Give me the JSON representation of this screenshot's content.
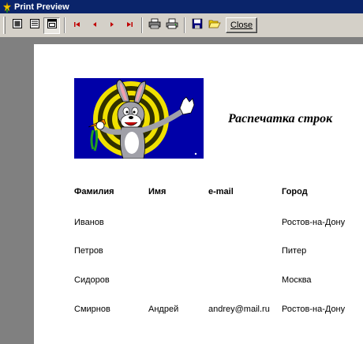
{
  "window": {
    "title": "Print Preview"
  },
  "toolbar": {
    "buttons": [
      {
        "name": "one-page-icon"
      },
      {
        "name": "two-pages-icon"
      },
      {
        "name": "page-width-icon"
      },
      {
        "name": "first-page-icon"
      },
      {
        "name": "prev-page-icon"
      },
      {
        "name": "next-page-icon"
      },
      {
        "name": "last-page-icon"
      },
      {
        "name": "print-setup-icon"
      },
      {
        "name": "print-icon"
      },
      {
        "name": "save-icon"
      },
      {
        "name": "open-icon"
      }
    ],
    "close_label": "Close"
  },
  "report": {
    "title": "Распечатка строк",
    "columns": [
      "Фамилия",
      "Имя",
      "e-mail",
      "Город"
    ],
    "rows": [
      [
        "Иванов",
        "",
        "",
        "Ростов-на-Дону"
      ],
      [
        "Петров",
        "",
        "",
        "Питер"
      ],
      [
        "Сидоров",
        "",
        "",
        "Москва"
      ],
      [
        "Смирнов",
        "Андрей",
        "andrey@mail.ru",
        "Ростов-на-Дону"
      ]
    ]
  }
}
